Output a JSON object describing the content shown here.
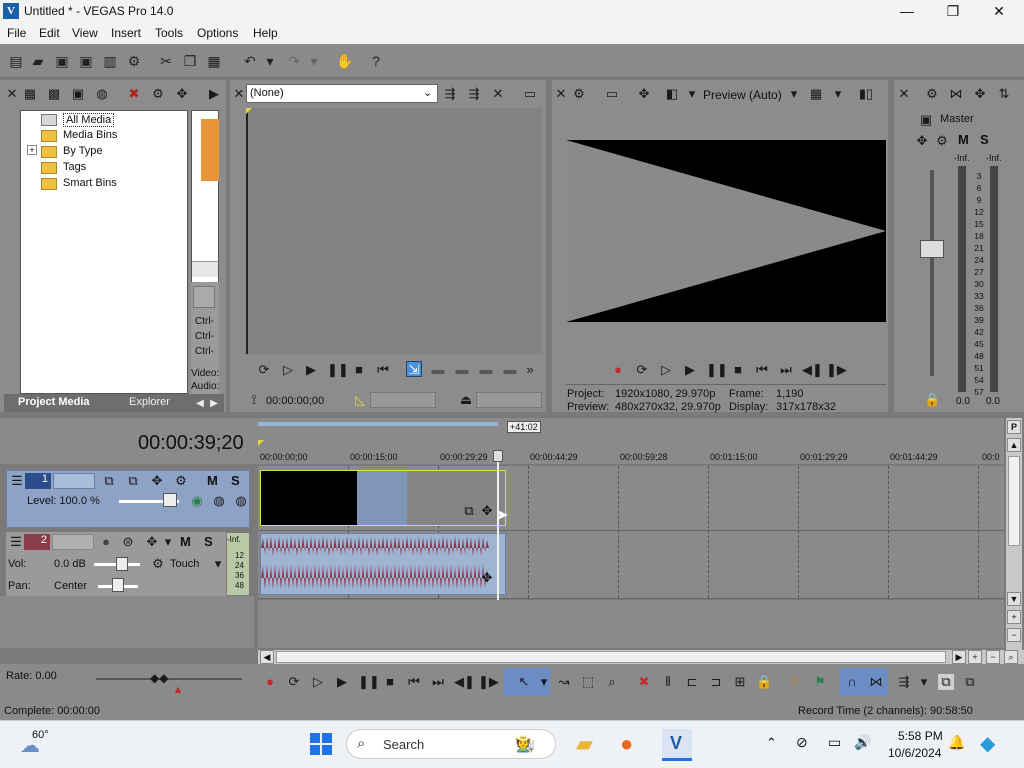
{
  "window": {
    "title": "Untitled * - VEGAS Pro 14.0",
    "minimize": "—",
    "maximize": "❐",
    "close": "✕"
  },
  "menu": [
    "File",
    "Edit",
    "View",
    "Insert",
    "Tools",
    "Options",
    "Help"
  ],
  "project_media": {
    "tree": [
      "All Media",
      "Media Bins",
      "By Type",
      "Tags",
      "Smart Bins"
    ],
    "expander": "+",
    "thumb_labels": [
      "Ctrl-",
      "Ctrl-",
      "Ctrl-"
    ],
    "info_labels": [
      "Video:",
      "Audio:"
    ],
    "tabs": [
      "Project Media",
      "Explorer"
    ]
  },
  "trimmer": {
    "dropdown_value": "(None)",
    "timecode": "00:00:00;00"
  },
  "preview": {
    "quality": "Preview (Auto)",
    "project_label": "Project:",
    "project_value": "1920x1080, 29.970p",
    "preview_label": "Preview:",
    "preview_value": "480x270x32, 29.970p",
    "frame_label": "Frame:",
    "frame_value": "1,190",
    "display_label": "Display:",
    "display_value": "317x178x32"
  },
  "mixer": {
    "master_label": "Master",
    "m_label": "M",
    "s_label": "S",
    "inf_left": "-Inf.",
    "inf_right": "-Inf.",
    "scale": [
      "3",
      "6",
      "9",
      "12",
      "15",
      "18",
      "21",
      "24",
      "27",
      "30",
      "33",
      "36",
      "39",
      "42",
      "45",
      "48",
      "51",
      "54",
      "57"
    ],
    "bottom_left": "0.0",
    "bottom_right": "0.0"
  },
  "timeline": {
    "current_time": "00:00:39;20",
    "cursor_badge": "+41:02",
    "ruler": [
      "00:00:00;00",
      "00:00:15;00",
      "00:00:29;29",
      "00:00:44;29",
      "00:00:59;28",
      "00:01:15;00",
      "00:01:29;29",
      "00:01:44;29",
      "00:0"
    ],
    "track1": {
      "number": "1",
      "m": "M",
      "s": "S",
      "level": "Level: 100.0 %"
    },
    "track2": {
      "number": "2",
      "m": "M",
      "s": "S",
      "vol_label": "Vol:",
      "vol_value": "0.0 dB",
      "pan_label": "Pan:",
      "pan_value": "Center",
      "automation": "Touch",
      "meter": [
        "-Inf.",
        "12",
        "24",
        "36",
        "48"
      ]
    }
  },
  "transport": {
    "rate": "Rate: 0.00"
  },
  "status": {
    "complete": "Complete: 00:00:00",
    "record_time": "Record Time (2 channels): 90:58:50"
  },
  "taskbar": {
    "weather_temp": "60°",
    "search_placeholder": "Search",
    "time": "5:58 PM",
    "date": "10/6/2024"
  },
  "colors": {
    "audio_wave": "#8a3c4a",
    "track1_bg": "#8da2c4",
    "accent_blue": "#1b5fa8",
    "event_border": "#d6e24a"
  }
}
